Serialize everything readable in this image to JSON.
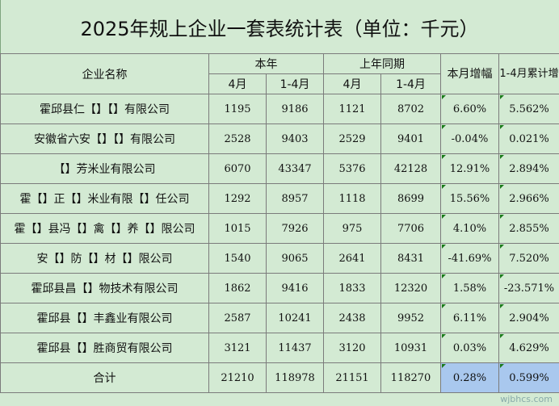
{
  "title": "2025年规上企业一套表统计表（单位：千元）",
  "headers": {
    "company": "企业名称",
    "this_year": "本年",
    "last_year": "上年同期",
    "month_growth": "本月增幅",
    "ytd_growth": "1-4月累计增",
    "apr": "4月",
    "ytd": "1-4月"
  },
  "rows": [
    {
      "name": "霍邱县仁【】【】有限公司",
      "apr": "1195",
      "ytd": "9186",
      "ly_apr": "1121",
      "ly_ytd": "8702",
      "m": "6.60%",
      "y": "5.562%"
    },
    {
      "name": "安徽省六安【】【】有限公司",
      "apr": "2528",
      "ytd": "9403",
      "ly_apr": "2529",
      "ly_ytd": "9401",
      "m": "-0.04%",
      "y": "0.021%"
    },
    {
      "name": "【】芳米业有限公司",
      "apr": "6070",
      "ytd": "43347",
      "ly_apr": "5376",
      "ly_ytd": "42128",
      "m": "12.91%",
      "y": "2.894%"
    },
    {
      "name": "霍【】正【】米业有限【】任公司",
      "apr": "1292",
      "ytd": "8957",
      "ly_apr": "1118",
      "ly_ytd": "8699",
      "m": "15.56%",
      "y": "2.966%"
    },
    {
      "name": "霍【】县冯【】禽【】养【】限公司",
      "apr": "1015",
      "ytd": "7926",
      "ly_apr": "975",
      "ly_ytd": "7706",
      "m": "4.10%",
      "y": "2.855%"
    },
    {
      "name": "安【】防【】材【】限公司",
      "apr": "1540",
      "ytd": "9065",
      "ly_apr": "2641",
      "ly_ytd": "8431",
      "m": "-41.69%",
      "y": "7.520%"
    },
    {
      "name": "霍邱县昌【】物技术有限公司",
      "apr": "1862",
      "ytd": "9416",
      "ly_apr": "1833",
      "ly_ytd": "12320",
      "m": "1.58%",
      "y": "-23.571%"
    },
    {
      "name": "霍邱县【】丰鑫业有限公司",
      "apr": "2587",
      "ytd": "10241",
      "ly_apr": "2438",
      "ly_ytd": "9952",
      "m": "6.11%",
      "y": "2.904%"
    },
    {
      "name": "霍邱县【】胜商贸有限公司",
      "apr": "3121",
      "ytd": "11437",
      "ly_apr": "3120",
      "ly_ytd": "10931",
      "m": "0.03%",
      "y": "4.629%"
    }
  ],
  "total": {
    "name": "合计",
    "apr": "21210",
    "ytd": "118978",
    "ly_apr": "21151",
    "ly_ytd": "118270",
    "m": "0.28%",
    "y": "0.599%"
  },
  "watermark": "wjbhcs.com"
}
